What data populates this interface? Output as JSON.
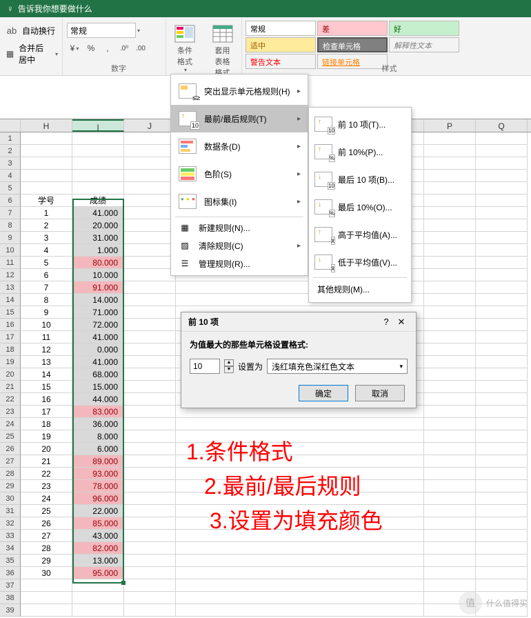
{
  "titlebar": {
    "hint": "告诉我你想要做什么"
  },
  "ribbon": {
    "wrap_on": "自动换行",
    "merge": "合并后居中",
    "number_group": "数字",
    "number_format": "常规",
    "cond_fmt": "条件格式",
    "table_fmt": "套用\n表格格式",
    "styles_group": "样式",
    "style_preview": "常规",
    "check_cell": "检查单元格",
    "styles": {
      "bad": "差",
      "good": "好",
      "neutral": "适中",
      "explain": "解释性文本",
      "warn": "警告文本",
      "link": "链接单元格"
    }
  },
  "columns": [
    "H",
    "I",
    "J",
    "P",
    "Q"
  ],
  "data_header": {
    "id": "学号",
    "score": "成绩"
  },
  "score_rows": [
    {
      "n": 1,
      "v": "41.000",
      "hl": false
    },
    {
      "n": 2,
      "v": "20.000",
      "hl": false
    },
    {
      "n": 3,
      "v": "31.000",
      "hl": false
    },
    {
      "n": 4,
      "v": "1.000",
      "hl": false
    },
    {
      "n": 5,
      "v": "80.000",
      "hl": true
    },
    {
      "n": 6,
      "v": "10.000",
      "hl": false
    },
    {
      "n": 7,
      "v": "91.000",
      "hl": true
    },
    {
      "n": 8,
      "v": "14.000",
      "hl": false
    },
    {
      "n": 9,
      "v": "71.000",
      "hl": false
    },
    {
      "n": 10,
      "v": "72.000",
      "hl": false
    },
    {
      "n": 11,
      "v": "41.000",
      "hl": false
    },
    {
      "n": 12,
      "v": "0.000",
      "hl": false
    },
    {
      "n": 13,
      "v": "41.000",
      "hl": false
    },
    {
      "n": 14,
      "v": "68.000",
      "hl": false
    },
    {
      "n": 15,
      "v": "15.000",
      "hl": false
    },
    {
      "n": 16,
      "v": "44.000",
      "hl": false
    },
    {
      "n": 17,
      "v": "83.000",
      "hl": true
    },
    {
      "n": 18,
      "v": "36.000",
      "hl": false
    },
    {
      "n": 19,
      "v": "8.000",
      "hl": false
    },
    {
      "n": 20,
      "v": "6.000",
      "hl": false
    },
    {
      "n": 21,
      "v": "89.000",
      "hl": true
    },
    {
      "n": 22,
      "v": "93.000",
      "hl": true
    },
    {
      "n": 23,
      "v": "78.000",
      "hl": true
    },
    {
      "n": 24,
      "v": "96.000",
      "hl": true
    },
    {
      "n": 25,
      "v": "22.000",
      "hl": false
    },
    {
      "n": 26,
      "v": "85.000",
      "hl": true
    },
    {
      "n": 27,
      "v": "43.000",
      "hl": false
    },
    {
      "n": 28,
      "v": "82.000",
      "hl": true
    },
    {
      "n": 29,
      "v": "13.000",
      "hl": false
    },
    {
      "n": 30,
      "v": "95.000",
      "hl": true
    }
  ],
  "menu1": {
    "highlight": "突出显示单元格规则(H)",
    "topbottom": "最前/最后规则(T)",
    "databar": "数据条(D)",
    "colorscale": "色阶(S)",
    "iconset": "图标集(I)",
    "new": "新建规则(N)...",
    "clear": "清除规则(C)",
    "manage": "管理规则(R)..."
  },
  "menu2": {
    "top10": "前 10 项(T)...",
    "top10p": "前 10%(P)...",
    "bot10": "最后 10 项(B)...",
    "bot10p": "最后 10%(O)...",
    "above": "高于平均值(A)...",
    "below": "低于平均值(V)...",
    "other": "其他规则(M)..."
  },
  "dlg": {
    "title": "前 10 项",
    "desc": "为值最大的那些单元格设置格式:",
    "value": "10",
    "set_as": "设置为",
    "format_opt": "浅红填充色深红色文本",
    "ok": "确定",
    "cancel": "取消"
  },
  "annotation": {
    "l1": "1.条件格式",
    "l2": "2.最前/最后规则",
    "l3": "3.设置为填充颜色"
  },
  "watermark": {
    "text": "什么值得买",
    "logo": "值"
  }
}
